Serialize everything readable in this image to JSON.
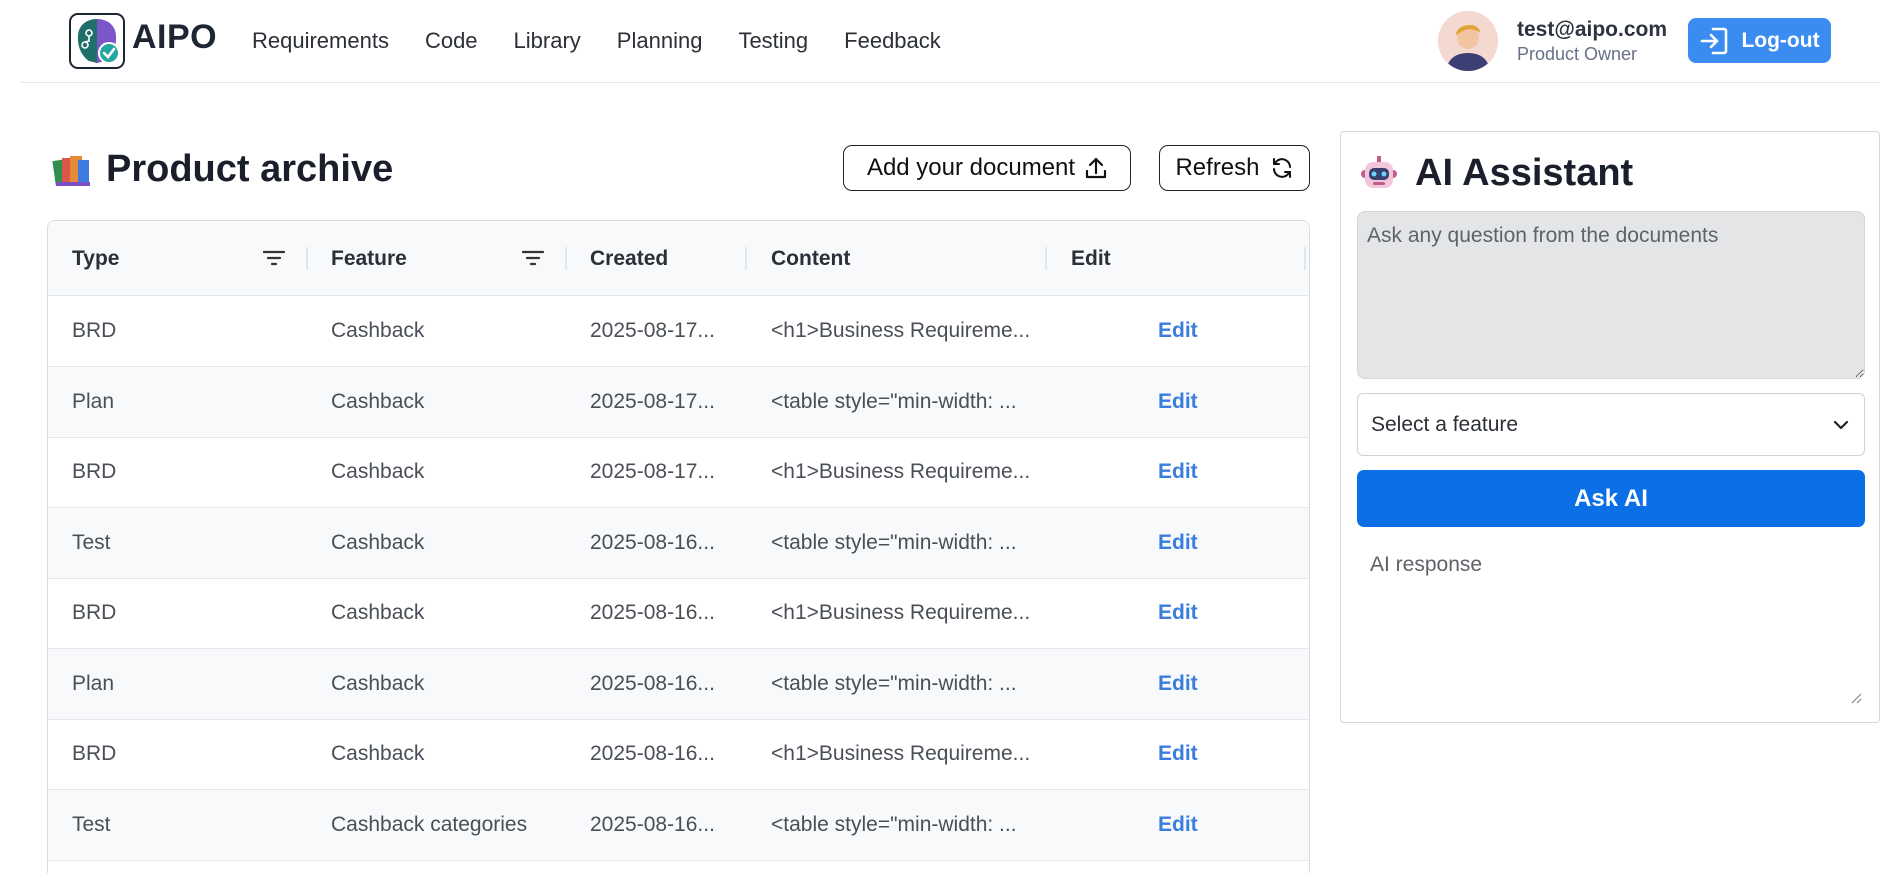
{
  "header": {
    "brand": "AIPO",
    "nav": [
      "Requirements",
      "Code",
      "Library",
      "Planning",
      "Testing",
      "Feedback"
    ],
    "user_email": "test@aipo.com",
    "user_role": "Product Owner",
    "logout_label": "Log-out"
  },
  "archive": {
    "title": "Product archive",
    "add_button": "Add your document",
    "refresh_button": "Refresh",
    "columns": [
      "Type",
      "Feature",
      "Created",
      "Content",
      "Edit"
    ],
    "rows": [
      {
        "type": "BRD",
        "feature": "Cashback",
        "created": "2025-08-17...",
        "content": "<h1>Business Requireme...",
        "edit": "Edit"
      },
      {
        "type": "Plan",
        "feature": "Cashback",
        "created": "2025-08-17...",
        "content": "<table style=\"min-width: ...",
        "edit": "Edit"
      },
      {
        "type": "BRD",
        "feature": "Cashback",
        "created": "2025-08-17...",
        "content": "<h1>Business Requireme...",
        "edit": "Edit"
      },
      {
        "type": "Test",
        "feature": "Cashback",
        "created": "2025-08-16...",
        "content": "<table style=\"min-width: ...",
        "edit": "Edit"
      },
      {
        "type": "BRD",
        "feature": "Cashback",
        "created": "2025-08-16...",
        "content": "<h1>Business Requireme...",
        "edit": "Edit"
      },
      {
        "type": "Plan",
        "feature": "Cashback",
        "created": "2025-08-16...",
        "content": "<table style=\"min-width: ...",
        "edit": "Edit"
      },
      {
        "type": "BRD",
        "feature": "Cashback",
        "created": "2025-08-16...",
        "content": "<h1>Business Requireme...",
        "edit": "Edit"
      },
      {
        "type": "Test",
        "feature": "Cashback categories",
        "created": "2025-08-16...",
        "content": "<table style=\"min-width: ...",
        "edit": "Edit"
      }
    ]
  },
  "ai": {
    "title": "AI Assistant",
    "question_placeholder": "Ask any question from the documents",
    "question_value": "",
    "feature_select_value": "Select a feature",
    "ask_button": "Ask AI",
    "response_placeholder": "AI response"
  },
  "colors": {
    "primary": "#0b6fe6",
    "logout": "#3b8cf0",
    "link": "#3b7ddd"
  },
  "icons": [
    "brain-check-icon",
    "upload-icon",
    "refresh-icon",
    "filter-icon",
    "robot-icon",
    "books-icon",
    "login-icon",
    "chevron-down-icon"
  ]
}
